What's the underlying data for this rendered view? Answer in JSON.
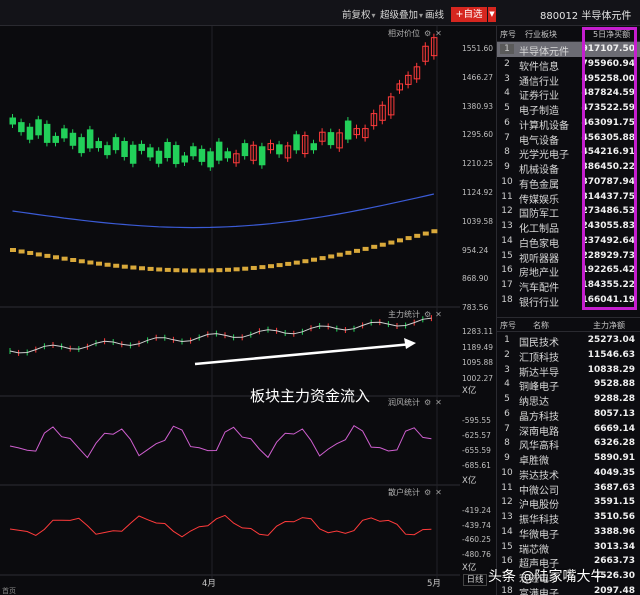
{
  "header": {
    "title": "880012 半导体元件",
    "buttons": {
      "prefuquan": "前复权",
      "superposition": "超级叠加",
      "drawline": "画线",
      "add_self": "+自选"
    }
  },
  "axis": {
    "price_ticks": [
      "1551.60",
      "1466.27",
      "1380.93",
      "1295.60",
      "1210.25",
      "1124.92",
      "1039.58",
      "954.24",
      "868.90",
      "783.56"
    ],
    "main_ticks": [
      "1283.11",
      "1189.49",
      "1095.88",
      "1002.27"
    ],
    "main_unit": "X亿",
    "rb_ticks": [
      "-595.55",
      "-625.57",
      "-655.59",
      "-685.61"
    ],
    "rb_unit": "X亿",
    "ret_ticks": [
      "-419.24",
      "-439.74",
      "-460.25",
      "-480.76"
    ],
    "ret_unit": "X亿",
    "daily": "日线"
  },
  "panels": {
    "price_label": "相对价位",
    "main_label": "主力统计",
    "rb_label": "润风统计",
    "ret_label": "散户统计"
  },
  "annotation": "板块主力资金流入",
  "months": {
    "apr": "4月",
    "may": "5月"
  },
  "bottom_label": "首页",
  "sector_table": {
    "headers": {
      "idx": "序号",
      "name": "行业板块",
      "value": "5日净买额"
    },
    "rows": [
      {
        "idx": "1",
        "name": "半导体元件",
        "value": "917107.50"
      },
      {
        "idx": "2",
        "name": "软件信息",
        "value": "795960.94"
      },
      {
        "idx": "3",
        "name": "通信行业",
        "value": "495258.00"
      },
      {
        "idx": "4",
        "name": "证券行业",
        "value": "487824.59"
      },
      {
        "idx": "5",
        "name": "电子制造",
        "value": "473522.59"
      },
      {
        "idx": "6",
        "name": "计算机设备",
        "value": "463091.75"
      },
      {
        "idx": "7",
        "name": "电气设备",
        "value": "456305.88"
      },
      {
        "idx": "8",
        "name": "光学光电子",
        "value": "454216.91"
      },
      {
        "idx": "9",
        "name": "机械设备",
        "value": "386450.22"
      },
      {
        "idx": "10",
        "name": "有色金属",
        "value": "370787.94"
      },
      {
        "idx": "11",
        "name": "传媒娱乐",
        "value": "314437.75"
      },
      {
        "idx": "12",
        "name": "国防军工",
        "value": "273486.53"
      },
      {
        "idx": "13",
        "name": "化工制品",
        "value": "243055.83"
      },
      {
        "idx": "14",
        "name": "白色家电",
        "value": "237492.64"
      },
      {
        "idx": "15",
        "name": "视听器器",
        "value": "228929.73"
      },
      {
        "idx": "16",
        "name": "房地产业",
        "value": "192265.42"
      },
      {
        "idx": "17",
        "name": "汽车配件",
        "value": "184355.22"
      },
      {
        "idx": "18",
        "name": "银行行业",
        "value": "166041.19"
      }
    ]
  },
  "stock_table": {
    "headers": {
      "idx": "序号",
      "name": "名称",
      "value": "主力净额"
    },
    "rows": [
      {
        "idx": "1",
        "name": "国民技术",
        "value": "25273.04"
      },
      {
        "idx": "2",
        "name": "汇顶科技",
        "value": "11546.63"
      },
      {
        "idx": "3",
        "name": "斯达半导",
        "value": "10838.29"
      },
      {
        "idx": "4",
        "name": "铜峰电子",
        "value": "9528.88"
      },
      {
        "idx": "5",
        "name": "纳思达",
        "value": "9288.28"
      },
      {
        "idx": "6",
        "name": "晶方科技",
        "value": "8057.13"
      },
      {
        "idx": "7",
        "name": "深南电路",
        "value": "6669.14"
      },
      {
        "idx": "8",
        "name": "风华高科",
        "value": "6326.28"
      },
      {
        "idx": "9",
        "name": "卓胜微",
        "value": "5890.91"
      },
      {
        "idx": "10",
        "name": "崇达技术",
        "value": "4049.35"
      },
      {
        "idx": "11",
        "name": "中微公司",
        "value": "3687.63"
      },
      {
        "idx": "12",
        "name": "沪电股份",
        "value": "3591.15"
      },
      {
        "idx": "13",
        "name": "振华科技",
        "value": "3510.56"
      },
      {
        "idx": "14",
        "name": "华微电子",
        "value": "3388.96"
      },
      {
        "idx": "15",
        "name": "瑞芯微",
        "value": "3013.34"
      },
      {
        "idx": "16",
        "name": "超声电子",
        "value": "2663.73"
      },
      {
        "idx": "17",
        "name": "宏达电子",
        "value": "2526.30"
      },
      {
        "idx": "18",
        "name": "富满电子",
        "value": "2097.48"
      }
    ]
  },
  "watermark": "头条 @陆家嘴大牛",
  "colors": {
    "up": "#ff3b3b",
    "down": "#22d05a",
    "highlight": "#c51ecf",
    "blue_ma": "#3b5bd6",
    "gold": "#d9a93b"
  }
}
